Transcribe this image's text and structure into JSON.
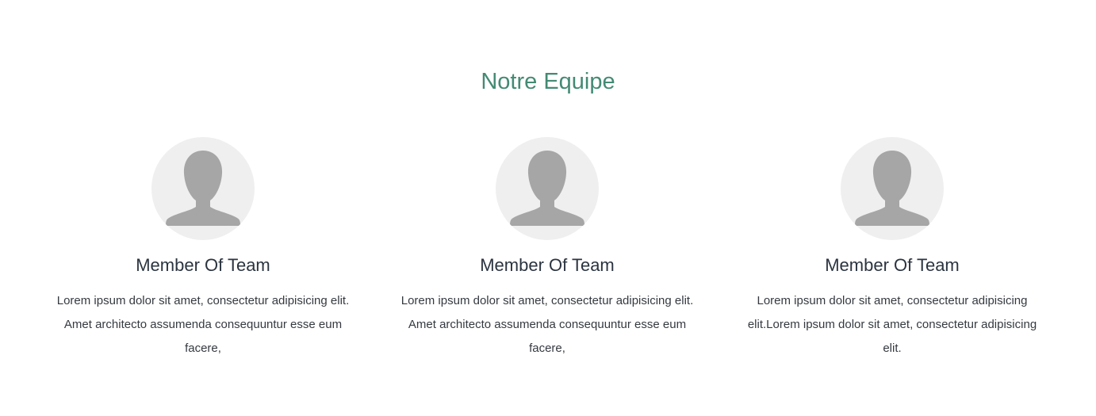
{
  "section": {
    "title": "Notre Equipe"
  },
  "members": [
    {
      "icon": "user-silhouette-icon",
      "name": "Member Of Team",
      "text": "Lorem ipsum dolor sit amet, consectetur adipisicing elit. Amet architecto assumenda consequuntur esse eum facere,"
    },
    {
      "icon": "user-silhouette-icon",
      "name": "Member Of Team",
      "text": "Lorem ipsum dolor sit amet, consectetur adipisicing elit. Amet architecto assumenda consequuntur esse eum facere,"
    },
    {
      "icon": "user-silhouette-icon",
      "name": "Member Of Team",
      "text": "Lorem ipsum dolor sit amet, consectetur adipisicing elit.Lorem ipsum dolor sit amet, consectetur adipisicing elit."
    }
  ],
  "colors": {
    "title": "#438a74",
    "avatar_bg": "#efefef",
    "avatar_fg": "#a6a6a6",
    "text": "#353a40"
  }
}
